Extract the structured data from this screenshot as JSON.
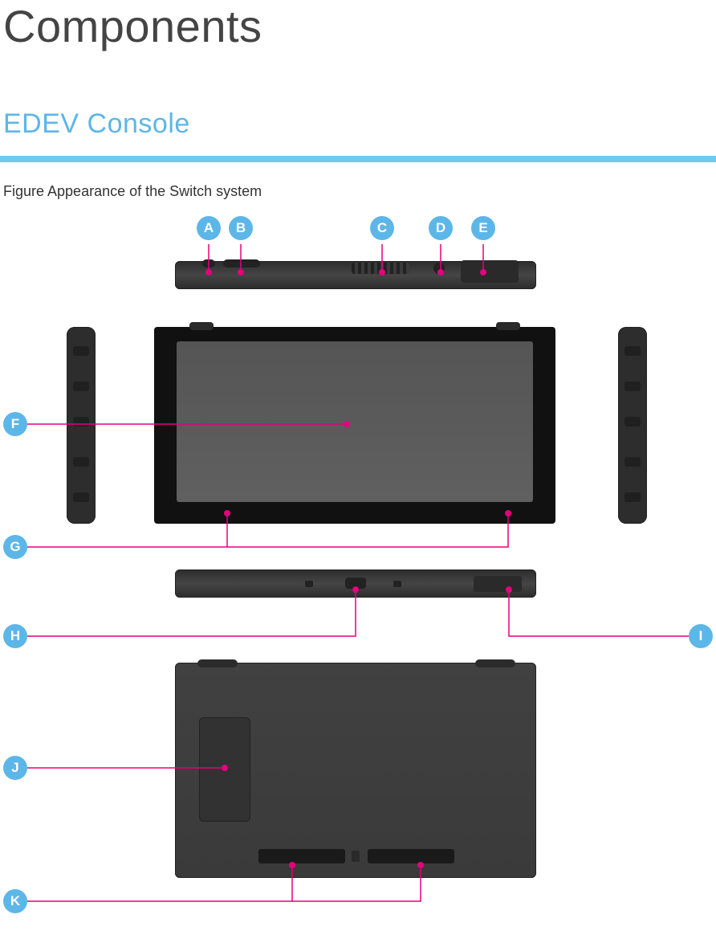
{
  "title": "Components",
  "section": "EDEV Console",
  "caption": "Figure Appearance of the Switch system",
  "labels": {
    "a": "A",
    "b": "B",
    "c": "C",
    "d": "D",
    "e": "E",
    "f": "F",
    "g": "G",
    "h": "H",
    "i": "I",
    "j": "J",
    "k": "K"
  }
}
